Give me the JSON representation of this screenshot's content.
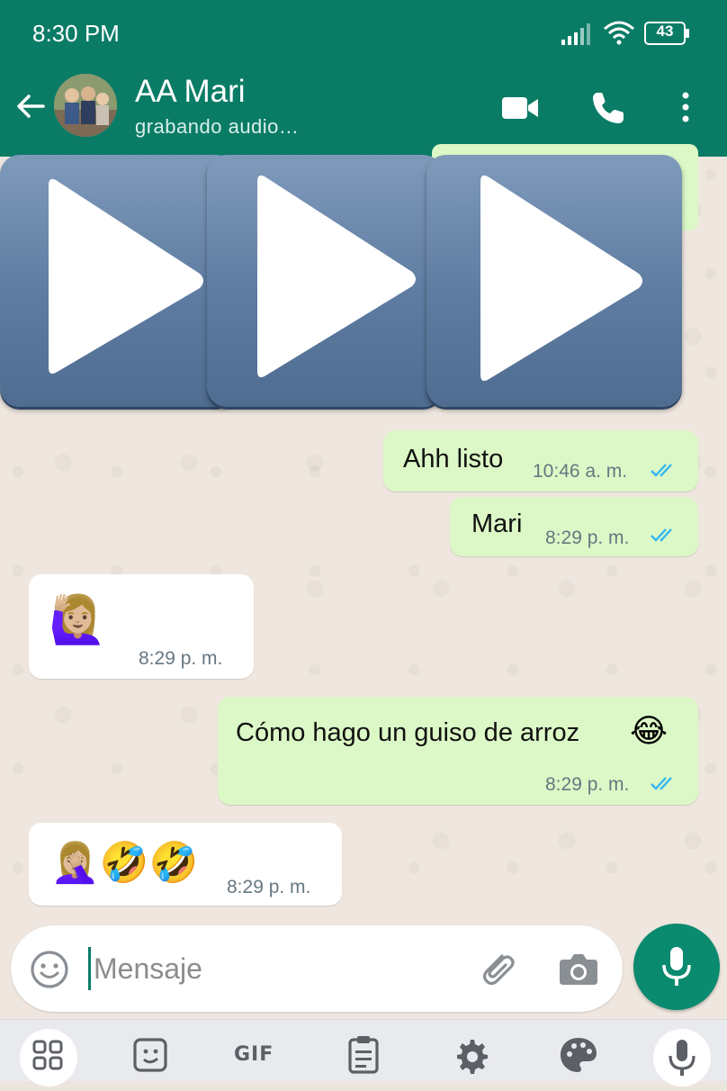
{
  "status_bar": {
    "time": "8:30 PM",
    "battery": "43"
  },
  "header": {
    "contact_name": "AA Mari",
    "contact_status": "grabando audio…"
  },
  "messages": [
    {
      "type": "outgoing",
      "text": "Ahh listo",
      "time": "10:46 a. m.",
      "status": "read"
    },
    {
      "type": "outgoing",
      "text": "Mari",
      "time": "8:29 p. m.",
      "status": "read"
    },
    {
      "type": "incoming",
      "emoji": "🙋🏼‍♀️",
      "time": "8:29 p. m."
    },
    {
      "type": "outgoing",
      "text": "Cómo hago un guiso de arroz",
      "emoji": "😂",
      "time": "8:29 p. m.",
      "status": "read"
    },
    {
      "type": "incoming",
      "emoji": "🤦🏼‍♀️🤣🤣",
      "time": "8:29 p. m."
    }
  ],
  "composer": {
    "placeholder": "Mensaje"
  },
  "keyboard_toolbar": {
    "gif_label": "GIF"
  },
  "colors": {
    "header": "#0a7c66",
    "outgoing_bubble": "#dcf8c6",
    "incoming_bubble": "#ffffff",
    "tick_read": "#34b7f1",
    "mic_button": "#0a8a6e"
  },
  "icons": [
    "back-arrow-icon",
    "video-call-icon",
    "phone-icon",
    "more-vert-icon",
    "play-icon",
    "emoji-icon",
    "attach-icon",
    "camera-icon",
    "mic-icon",
    "apps-grid-icon",
    "sticker-icon",
    "clipboard-icon",
    "settings-icon",
    "palette-icon"
  ]
}
